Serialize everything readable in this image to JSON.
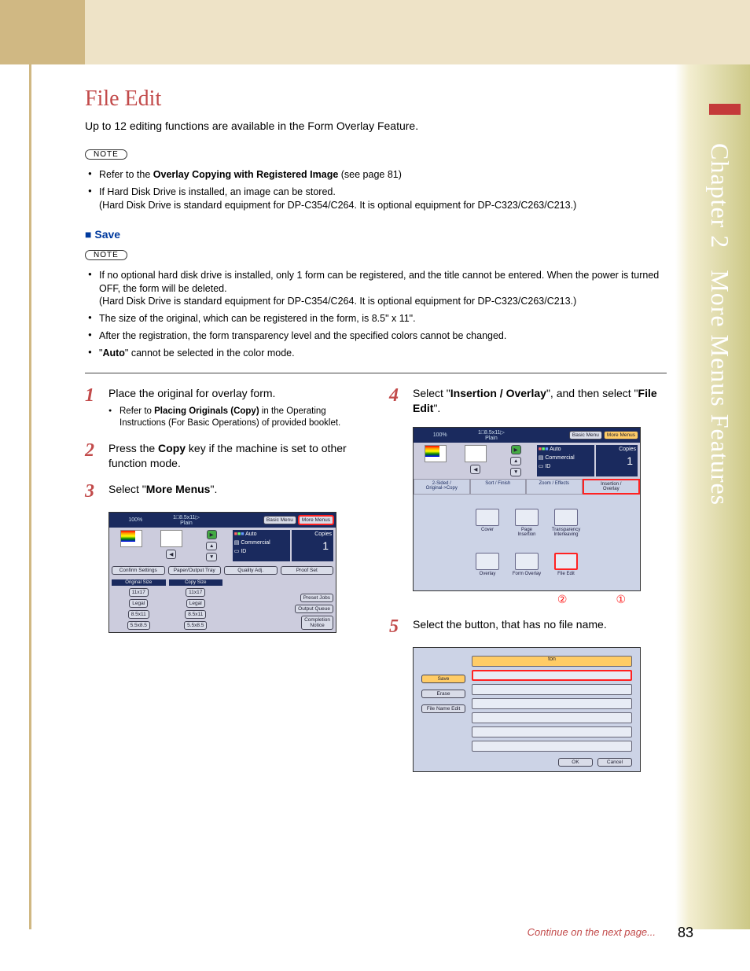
{
  "sidebar": {
    "chapter": "Chapter 2",
    "title": "More Menus Features"
  },
  "page": {
    "title": "File Edit",
    "intro": "Up to 12 editing functions are available in the Form Overlay Feature.",
    "note_label": "NOTE",
    "notes1": {
      "items": [
        {
          "pre": "Refer to the ",
          "bold": "Overlay Copying with Registered Image",
          "post": " (see page 81)"
        },
        {
          "text": "If Hard Disk Drive is installed, an image can be stored.\n(Hard Disk Drive is standard equipment for DP-C354/C264. It is optional equipment for DP-C323/C263/C213.)"
        }
      ]
    },
    "save_heading": "Save",
    "notes2": {
      "items": [
        {
          "text": "If no optional hard disk drive is installed, only 1 form can be registered, and the title cannot be entered. When the power is turned OFF, the form will be deleted.\n(Hard Disk Drive is standard equipment for DP-C354/C264. It is optional equipment for DP-C323/C263/C213.)"
        },
        {
          "text": "The size of the original, which can be registered in the form, is 8.5\" x 11\"."
        },
        {
          "text": "After the registration, the form transparency level and the specified colors cannot be changed."
        },
        {
          "pre": "\"",
          "bold": "Auto",
          "post": "\" cannot be selected in the color mode."
        }
      ]
    },
    "steps": {
      "s1": {
        "num": "1",
        "text": "Place the original for overlay form.",
        "sub_pre": "Refer to ",
        "sub_bold": "Placing Originals (Copy)",
        "sub_post": " in the Operating Instructions (For Basic Operations) of provided booklet."
      },
      "s2": {
        "num": "2",
        "pre": "Press the ",
        "bold": "Copy",
        "post": " key if the machine is set to other function mode."
      },
      "s3": {
        "num": "3",
        "pre": "Select \"",
        "bold": "More Menus",
        "post": "\"."
      },
      "s4": {
        "num": "4",
        "pre": "Select \"",
        "bold": "Insertion / Overlay",
        "post": "\", and then select \"",
        "bold2": "File Edit",
        "post2": "\"."
      },
      "s5": {
        "num": "5",
        "text": "Select the button, that has no file name."
      }
    },
    "continue": "Continue on the next page...",
    "pagenum": "83"
  },
  "lcd_a": {
    "zoom": "100%",
    "paper": "1□8.5x11▷\nPlain",
    "basic": "Basic Menu",
    "more": "More Menus",
    "auto": "Auto",
    "commercial": "Commercial",
    "copies_label": "Copies",
    "copies": "1",
    "id": "ID",
    "confirm": "Confirm Settings",
    "paper_out": "Paper/Output Tray",
    "quality": "Quality Adj.",
    "proof": "Proof Set",
    "orig_size": "Original Size",
    "copy_size": "Copy Size",
    "s11x17": "11x17",
    "legal": "Legal",
    "s85x11": "8.5x11",
    "s55x85": "5.5x8.5",
    "preset": "Preset Jobs",
    "output_q": "Output Queue",
    "completion": "Completion\nNotice"
  },
  "lcd_b": {
    "zoom": "100%",
    "paper": "1□8.5x11▷\nPlain",
    "basic": "Basic Menu",
    "more": "More Menus",
    "auto": "Auto",
    "commercial": "Commercial",
    "copies_label": "Copies",
    "copies": "1",
    "id": "ID",
    "tab1": "2-Sided /\nOriginal->Copy",
    "tab2": "Sort / Finish",
    "tab3": "Zoom / Effects",
    "tab4": "Insertion /\nOverlay",
    "i1": "Cover",
    "i2": "Page\nInsertion",
    "i3": "Transparency\nInterleaving",
    "i4": "Overlay",
    "i5": "Form Overlay",
    "i6": "File Edit",
    "call2": "②",
    "call1": "①"
  },
  "lcd_c": {
    "header": "ton",
    "save": "Save",
    "erase": "Erase",
    "file_name_edit": "File Name Edit",
    "ok": "OK",
    "cancel": "Cancel"
  }
}
